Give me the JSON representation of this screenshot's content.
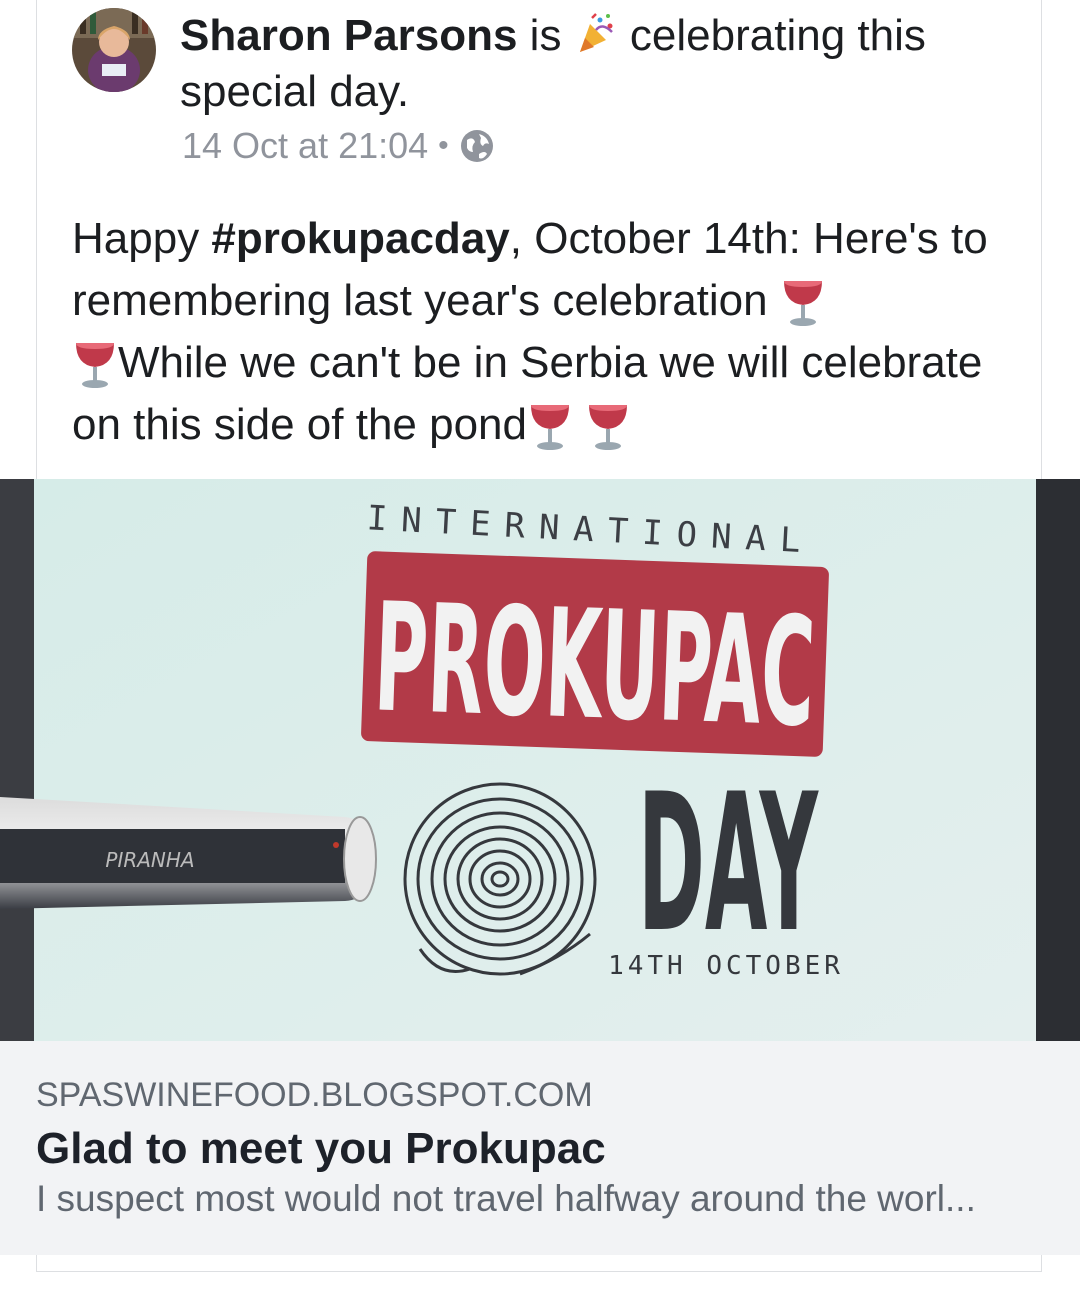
{
  "post": {
    "author": "Sharon Parsons",
    "activity_prefix": "is",
    "activity_icon": "party-popper-icon",
    "activity_text": "celebrating this special day.",
    "timestamp": "14 Oct at 21:04",
    "separator": "•",
    "privacy_icon": "globe-icon",
    "body": {
      "intro": "Happy ",
      "hashtag": "#prokupacday",
      "line1_rest": ", October 14th: Here's to remembering last year's celebration ",
      "line2": "While we can't be in Serbia we will celebrate on this side of the pond",
      "emoji": "wine-glass-icon"
    }
  },
  "photo": {
    "top_text": "INTERNATIONAL",
    "main_word": "PROKUPAC",
    "day_word": "DAY",
    "date_text": "14TH OCTOBER",
    "projector_brand": "PIRANHA"
  },
  "link_preview": {
    "domain": "SPASWINEFOOD.BLOGSPOT.COM",
    "title": "Glad to meet you Prokupac",
    "description": "I suspect most would not travel halfway around the worl..."
  },
  "colors": {
    "accent_red": "#b23a48",
    "meta_gray": "#90949c",
    "preview_bg": "#f2f3f5"
  }
}
